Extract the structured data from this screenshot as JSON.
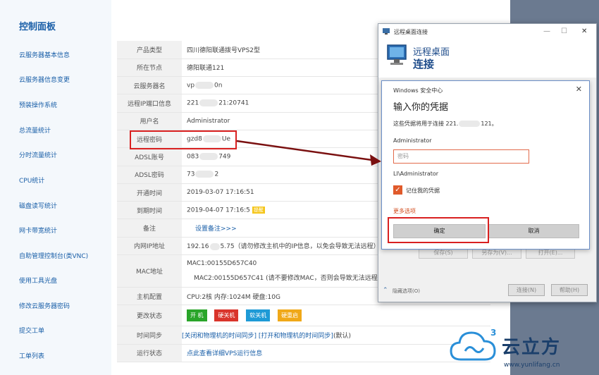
{
  "sidebar": {
    "title": "控制面板",
    "items": [
      "云服务器基本信息",
      "云服务器信息变更",
      "预装操作系统",
      "总流量统计",
      "分时流量统计",
      "CPU统计",
      "磁盘读写统计",
      "网卡带宽统计",
      "自助管理控制台(类VNC)",
      "使用工具光盘",
      "修改云服务器密码",
      "提交工单",
      "工单列表"
    ]
  },
  "info": {
    "product_type": {
      "label": "产品类型",
      "value": "四川德阳联通拨号VPS2型"
    },
    "node": {
      "label": "所在节点",
      "value": "德阳联通121"
    },
    "server_name": {
      "label": "云服务器名",
      "pre": "vp",
      "post": "0n"
    },
    "remote_ip": {
      "label": "远程IP端口信息",
      "pre": "221",
      "post": "21:20741"
    },
    "username": {
      "label": "用户名",
      "value": "Administrator"
    },
    "remote_pw": {
      "label": "远程密码",
      "pre": "gzd8",
      "post": "Ue"
    },
    "adsl_account": {
      "label": "ADSL账号",
      "pre": "083",
      "post": "749"
    },
    "adsl_pw": {
      "label": "ADSL密码",
      "pre": "73",
      "post": "2"
    },
    "open_time": {
      "label": "开通时间",
      "value": "2019-03-07 17:16:51"
    },
    "expire_time": {
      "label": "到期时间",
      "value": "2019-04-07 17:16:5",
      "badge": "提醒"
    },
    "note": {
      "label": "备注",
      "value": "设置备注>>>"
    },
    "lan_ip": {
      "label": "内网IP地址",
      "pre": "192.16",
      "post": "5.75（请勿修改主机中的IP信息，以免会导致无法远程）"
    },
    "mac": {
      "label": "MAC地址",
      "mac1": "MAC1:00155D657C40",
      "mac2": "MAC2:00155D657C41 (请不要修改MAC，否则会导致无法远程登"
    },
    "config": {
      "label": "主机配置",
      "value": "CPU:2核 内存:1024M 硬盘:10G"
    },
    "status": {
      "label": "更改状态",
      "buttons": [
        "开 机",
        "硬关机",
        "软关机",
        "硬重启"
      ]
    },
    "time_sync": {
      "label": "时间同步",
      "link1": "[关闭和物理机的时间同步]",
      "link2": "[打开和物理机的时间同步]",
      "default": "(默认)"
    },
    "run_status": {
      "label": "运行状态",
      "value": "点此查看详细VPS运行信息"
    }
  },
  "rdp": {
    "window_title": "远程桌面连接",
    "header_line1": "远程桌面",
    "header_line2": "连接",
    "ghost_buttons": [
      "保存(S)",
      "另存为(V)...",
      "打开(E)..."
    ],
    "hide_options": "隐藏选项(O)",
    "connect": "连接(N)",
    "help": "帮助(H)"
  },
  "security": {
    "title": "Windows 安全中心",
    "heading": "输入你的凭据",
    "description_pre": "这些凭据将用于连接 221.",
    "description_post": "121。",
    "username": "Administrator",
    "password_placeholder": "密码",
    "domain_user": "LI\\Administrator",
    "remember": "记住我的凭据",
    "more_options": "更多选项",
    "ok": "确定",
    "cancel": "取消"
  },
  "watermark": {
    "brand": "云立方",
    "url": "www.yunlifang.cn",
    "sup": "3"
  },
  "colors": {
    "accent": "#1a5fa8",
    "highlight": "#d92020",
    "arrow": "#7a1010"
  }
}
